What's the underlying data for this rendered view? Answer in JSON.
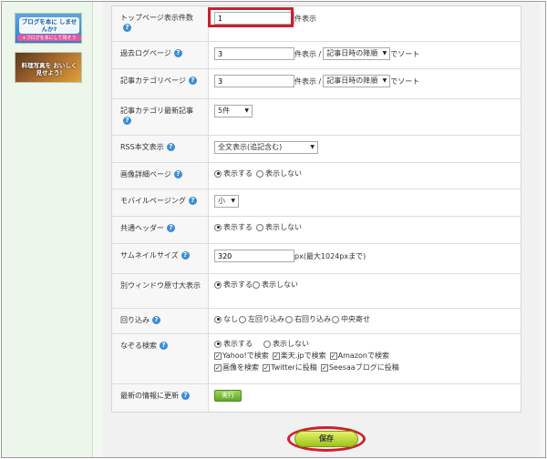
{
  "sidebar": {
    "banner1": {
      "text": "ブログを本に しませんか?",
      "sub": "+ブログを本にして残そう"
    },
    "banner2": {
      "text": "料理写真を おいしく見せよう!"
    }
  },
  "settings": {
    "top_count": {
      "label": "トップページ表示件数",
      "value": "1",
      "suffix": "件表示"
    },
    "past_log": {
      "label": "過去ログページ",
      "value": "3",
      "suffix": "件表示 /",
      "sort_select": "記事日時の降順",
      "sort_suffix": "でソート"
    },
    "category": {
      "label": "記事カテゴリページ",
      "value": "3",
      "suffix": "件表示 /",
      "sort_select": "記事日時の降順",
      "sort_suffix": "でソート"
    },
    "category_latest": {
      "label": "記事カテゴリ最新記事",
      "select": "5件"
    },
    "rss": {
      "label": "RSS本文表示",
      "select": "全文表示(追記含む)"
    },
    "image_detail": {
      "label": "画像詳細ページ",
      "opt_on": "表示する",
      "opt_off": "表示しない"
    },
    "mobile_paging": {
      "label": "モバイルページング",
      "select": "小"
    },
    "common_header": {
      "label": "共通ヘッダー",
      "opt_on": "表示する",
      "opt_off": "表示しない"
    },
    "thumbnail": {
      "label": "サムネイルサイズ",
      "value": "320",
      "suffix": "px(最大1024pxまで)"
    },
    "window": {
      "label": "別ウィンドウ原寸大表示",
      "opt_on": "表示する",
      "opt_off": "表示しない"
    },
    "wrap": {
      "label": "回り込み",
      "options": [
        "なし",
        "左回り込み",
        "右回り込み",
        "中央寄せ"
      ]
    },
    "trace": {
      "label": "なぞる検索",
      "opt_on": "表示する",
      "opt_off": "表示しない",
      "checks": [
        "Yahoo!で検索",
        "楽天.jpで検索",
        "Amazonで検索",
        "画像を検索",
        "Twitterに投稿",
        "Seesaaブログに投稿"
      ]
    },
    "update": {
      "label": "最新の情報に更新",
      "button": "実行"
    }
  },
  "save_label": "保存",
  "colors": {
    "highlight": "#cc1f2e",
    "help": "#3d8ed4"
  }
}
